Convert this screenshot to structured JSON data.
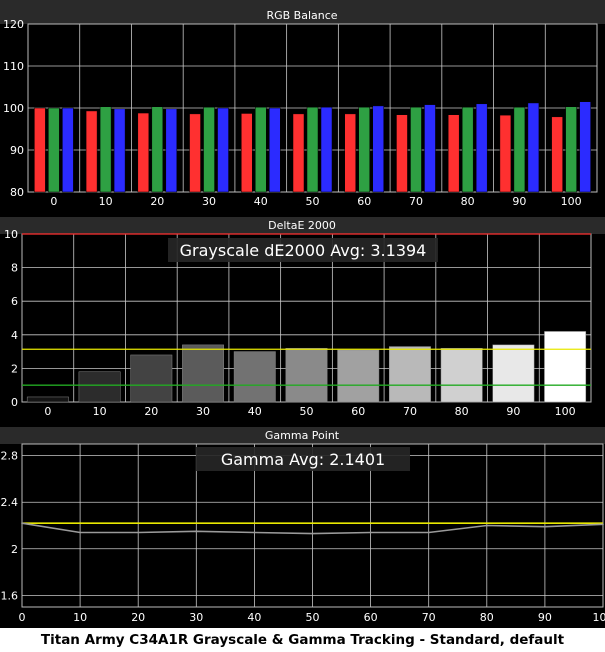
{
  "caption": "Titan Army C34A1R Grayscale & Gamma Tracking - Standard, default",
  "colors": {
    "background": "#000000",
    "panel_title_bar": "#2a2a2a",
    "grid": "#c8c8c8",
    "red": "#ff3030",
    "green": "#2ea043",
    "blue": "#2b2bff",
    "yellow": "#e8e800",
    "greenline": "#22aa22",
    "gamma_line": "#9a9a9a"
  },
  "chart_data": [
    {
      "type": "bar",
      "title": "RGB Balance",
      "categories": [
        "0",
        "10",
        "20",
        "30",
        "40",
        "50",
        "60",
        "70",
        "80",
        "90",
        "100"
      ],
      "ylim": [
        80,
        120
      ],
      "yticks": [
        80,
        90,
        100,
        110,
        120
      ],
      "grid": true,
      "series": [
        {
          "color": "red",
          "values": [
            100.0,
            99.3,
            98.8,
            98.6,
            98.7,
            98.6,
            98.6,
            98.4,
            98.4,
            98.3,
            97.9
          ]
        },
        {
          "color": "green",
          "values": [
            100.0,
            100.3,
            100.3,
            100.2,
            100.2,
            100.2,
            100.2,
            100.2,
            100.2,
            100.2,
            100.3
          ]
        },
        {
          "color": "blue",
          "values": [
            100.0,
            99.8,
            99.8,
            100.0,
            100.0,
            100.2,
            100.5,
            100.8,
            101.0,
            101.2,
            101.5
          ]
        }
      ]
    },
    {
      "type": "bar",
      "title": "DeltaE 2000",
      "annotation": "Grayscale dE2000 Avg: 3.1394",
      "categories": [
        "0",
        "10",
        "20",
        "30",
        "40",
        "50",
        "60",
        "70",
        "80",
        "90",
        "100"
      ],
      "values": [
        0.3,
        1.8,
        2.8,
        3.4,
        3.0,
        3.2,
        3.1,
        3.3,
        3.2,
        3.4,
        4.2
      ],
      "ylim": [
        0,
        10
      ],
      "yticks": [
        0,
        2,
        4,
        6,
        8,
        10
      ],
      "thresholds": [
        1,
        3.1394,
        10
      ],
      "grid": true
    },
    {
      "type": "line",
      "title": "Gamma Point",
      "annotation": "Gamma Avg: 2.1401",
      "x": [
        0,
        10,
        20,
        30,
        40,
        50,
        60,
        70,
        80,
        90,
        100
      ],
      "xticks": [
        "0",
        "10",
        "20",
        "30",
        "40",
        "50",
        "60",
        "70",
        "80",
        "90",
        "100"
      ],
      "values": [
        2.22,
        2.14,
        2.14,
        2.15,
        2.14,
        2.13,
        2.14,
        2.14,
        2.2,
        2.19,
        2.21
      ],
      "target": 2.22,
      "ylim": [
        1.5,
        2.9
      ],
      "yticks": [
        "1.6",
        "2",
        "2.4",
        "2.8"
      ],
      "grid": true
    }
  ]
}
